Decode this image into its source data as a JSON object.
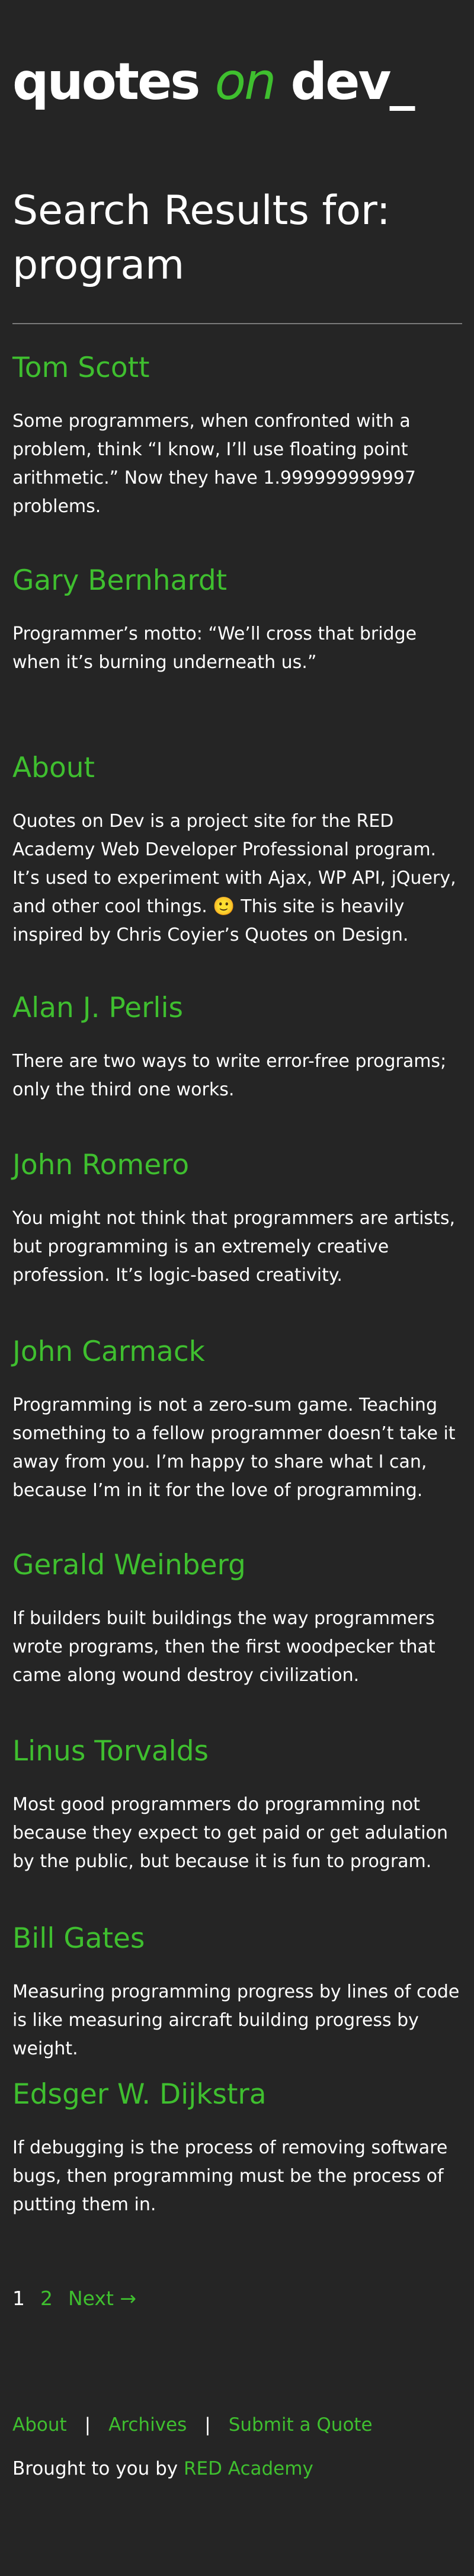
{
  "site": {
    "logo_part1": "quotes ",
    "logo_part2": "on",
    "logo_part3": " dev_"
  },
  "search": {
    "heading": "Search Results for: program"
  },
  "results": [
    {
      "author": "Tom Scott",
      "text": "Some programmers, when confronted with a problem, think “I know, I’ll use floating point arithmetic.” Now they have 1.999999999997 problems."
    },
    {
      "author": "Gary Bernhardt",
      "text": "Programmer’s motto: “We’ll cross that bridge when it’s burning underneath us.”"
    },
    {
      "author": "About",
      "text": "Quotes on Dev is a project site for the RED Academy Web Developer Professional program. It’s used to experiment with Ajax, WP API, jQuery, and other cool things. 🙂 This site is heavily inspired by Chris Coyier’s Quotes on Design."
    },
    {
      "author": "Alan J. Perlis",
      "text": "There are two ways to write error-free programs; only the third one works."
    },
    {
      "author": "John Romero",
      "text": "You might not think that programmers are artists, but programming is an extremely creative profession. It’s logic-based creativity."
    },
    {
      "author": "John Carmack",
      "text": "Programming is not a zero-sum game. Teaching something to a fellow programmer doesn’t take it away from you. I’m happy to share what I can, because I’m in it for the love of programming."
    },
    {
      "author": "Gerald Weinberg",
      "text": "If builders built buildings the way programmers wrote programs, then the first woodpecker that came along wound destroy civilization."
    },
    {
      "author": "Linus Torvalds",
      "text": "Most good programmers do programming not because they expect to get paid or get adulation by the public, but because it is fun to program."
    },
    {
      "author": "Bill Gates",
      "text": "Measuring programming progress by lines of code is like measuring aircraft building progress by weight."
    },
    {
      "author": "Edsger W. Dijkstra",
      "text": "If debugging is the process of removing software bugs, then programming must be the process of putting them in."
    }
  ],
  "pagination": {
    "current": "1",
    "page2": "2",
    "next": "Next →"
  },
  "footer": {
    "nav": {
      "about": "About",
      "archives": "Archives",
      "submit": "Submit a Quote",
      "separator": "|"
    },
    "credit_prefix": "Brought to you by ",
    "credit_link": "RED Academy"
  },
  "colors": {
    "background": "#252525",
    "accent": "#3fbf2f",
    "text": "#ffffff",
    "rule": "#7a7a7a"
  }
}
